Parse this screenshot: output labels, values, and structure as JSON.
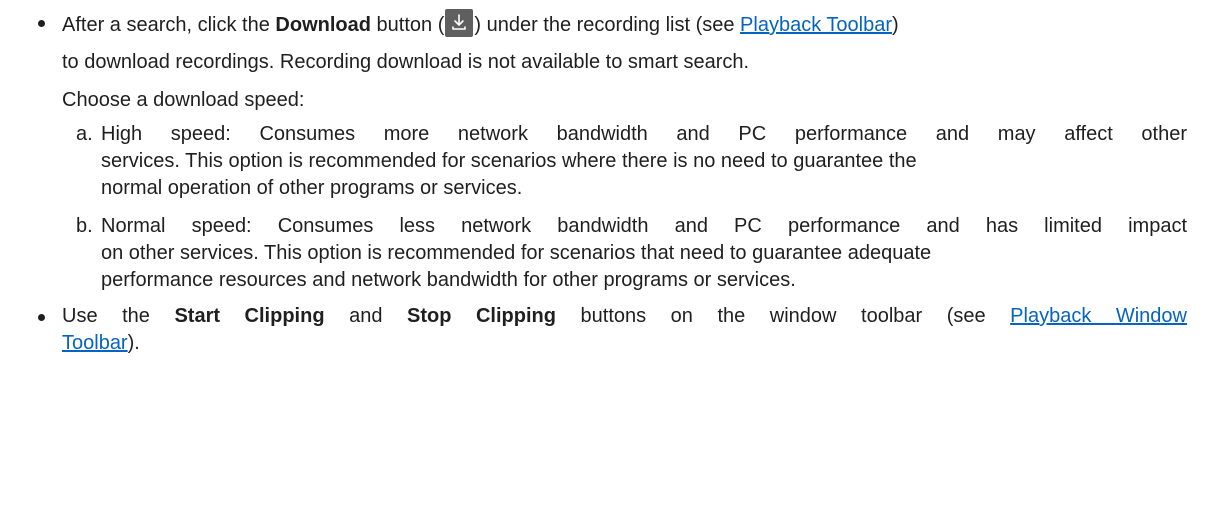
{
  "bullet1": {
    "pre": "After a search, click the ",
    "bold_download": "Download",
    "mid1": " button (",
    "icon": "download-icon",
    "mid2": ") under the recording list (see ",
    "link_toolbar": "Playback Toolbar",
    "post": ")",
    "line2": "to download recordings. Recording download is not available to smart search.",
    "line3": "Choose a download speed:"
  },
  "options": [
    {
      "marker": "a.",
      "lines": [
        "High speed: Consumes more network bandwidth and PC performance and may affect other",
        "services. This option is recommended for scenarios where there is no need to guarantee the",
        "normal operation of other programs or services."
      ]
    },
    {
      "marker": "b.",
      "lines": [
        "Normal speed: Consumes less network bandwidth and PC performance and has limited impact",
        "on other services. This option is recommended for scenarios that need to guarantee adequate",
        "performance resources and network bandwidth for other programs or services."
      ]
    }
  ],
  "bullet2": {
    "pre": "Use the ",
    "bold_start": "Start Clipping",
    "mid1": " and ",
    "bold_stop": "Stop Clipping",
    "mid2": " buttons on the window toolbar (see ",
    "link_part1": "Playback Window",
    "link_part2": "Toolbar",
    "post": ")."
  },
  "colors": {
    "link": "#0563c1",
    "text": "#1f1f1f",
    "icon_bg": "#5f5f5f"
  }
}
